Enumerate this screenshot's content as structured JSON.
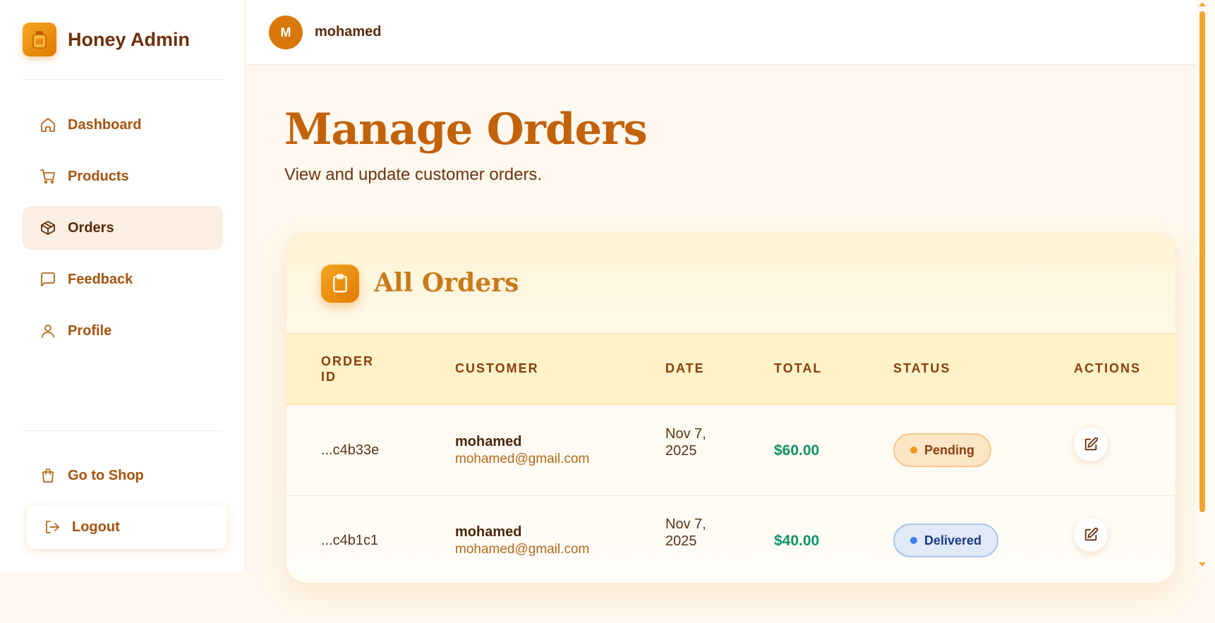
{
  "sidebar": {
    "brand": "Honey Admin",
    "items": [
      {
        "label": "Dashboard",
        "icon": "home-icon"
      },
      {
        "label": "Products",
        "icon": "cart-icon"
      },
      {
        "label": "Orders",
        "icon": "box-icon",
        "active": true
      },
      {
        "label": "Feedback",
        "icon": "message-icon"
      },
      {
        "label": "Profile",
        "icon": "user-icon"
      }
    ],
    "go_to_shop": "Go to Shop",
    "logout": "Logout"
  },
  "topbar": {
    "avatar_initial": "M",
    "username": "mohamed"
  },
  "page": {
    "title": "Manage Orders",
    "subtitle": "View and update customer orders."
  },
  "orders_card": {
    "title": "All Orders",
    "columns": [
      "ORDER ID",
      "CUSTOMER",
      "DATE",
      "TOTAL",
      "STATUS",
      "ACTIONS"
    ],
    "rows": [
      {
        "order_id": "...c4b33e",
        "customer_name": "mohamed",
        "customer_email": "mohamed@gmail.com",
        "date": "Nov 7, 2025",
        "total": "$60.00",
        "status": "Pending"
      },
      {
        "order_id": "...c4b1c1",
        "customer_name": "mohamed",
        "customer_email": "mohamed@gmail.com",
        "date": "Nov 7, 2025",
        "total": "$40.00",
        "status": "Delivered"
      }
    ]
  },
  "colors": {
    "accent": "#e07b00",
    "title": "#c2620a",
    "total_green": "#109267",
    "pending": "#f29a15",
    "delivered": "#3b82f6"
  }
}
